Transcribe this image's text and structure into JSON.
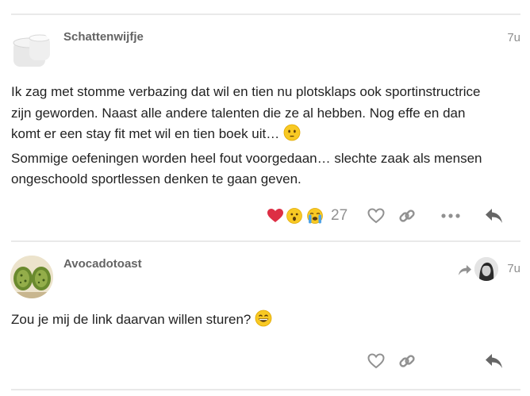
{
  "posts": [
    {
      "username": "Schattenwijfje",
      "time": "7u",
      "lines": [
        "Ik zag met stomme verbazing dat wil en tien nu plotsklaps ook sportinstructrice",
        "zijn geworden. Naast alle andere talenten die ze al hebben. Nog effe en dan",
        "komt er een stay fit met wil en tien boek uit…",
        "Sommige oefeningen worden heel fout voorgedaan… slechte zaak als mensen",
        "ongeschoold sportlessen denken te gaan geven."
      ],
      "reactions": [
        "heart",
        "astonished",
        "crying"
      ],
      "reaction_count": "27"
    },
    {
      "username": "Avocadotoast",
      "time": "7u",
      "lines": [
        "Zou je mij de link daarvan willen sturen?"
      ]
    }
  ],
  "colors": {
    "icon": "#919191",
    "heart_red": "#e0245e",
    "divider": "#e9e9e9",
    "username": "#646464"
  },
  "icons": [
    "like-heart-icon",
    "link-icon",
    "more-icon",
    "reply-icon",
    "reply-arrow-icon"
  ]
}
